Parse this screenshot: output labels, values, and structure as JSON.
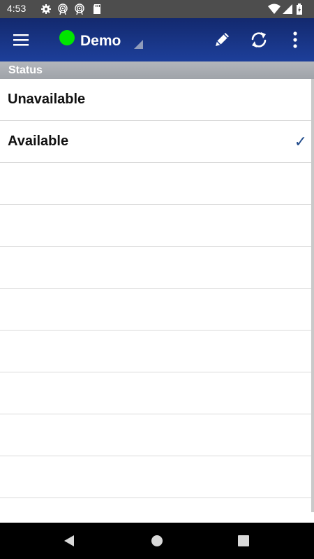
{
  "statusbar": {
    "time": "4:53",
    "icons": [
      "settings-icon",
      "hotspot-icon",
      "hotspot-icon",
      "sd-card-icon",
      "wifi-icon",
      "cell-signal-icon",
      "battery-charging-icon"
    ]
  },
  "appbar": {
    "title": "Demo",
    "status_color": "#00e600",
    "icons": [
      "menu-icon",
      "pencil-icon",
      "sync-icon",
      "overflow-menu-icon"
    ]
  },
  "section": {
    "header": "Status"
  },
  "list": {
    "items": [
      {
        "label": "Unavailable",
        "checked": false
      },
      {
        "label": "Available",
        "checked": true,
        "check_mark": "✓"
      },
      {
        "label": ""
      },
      {
        "label": ""
      },
      {
        "label": ""
      },
      {
        "label": ""
      },
      {
        "label": ""
      },
      {
        "label": ""
      },
      {
        "label": ""
      },
      {
        "label": ""
      }
    ]
  },
  "navbar": {
    "icons": [
      "back-icon",
      "home-icon",
      "recents-icon"
    ]
  },
  "colors": {
    "appbar": "#1d3f9a",
    "accent_check": "#1f4a8a",
    "section_header": "#a8acb1"
  }
}
